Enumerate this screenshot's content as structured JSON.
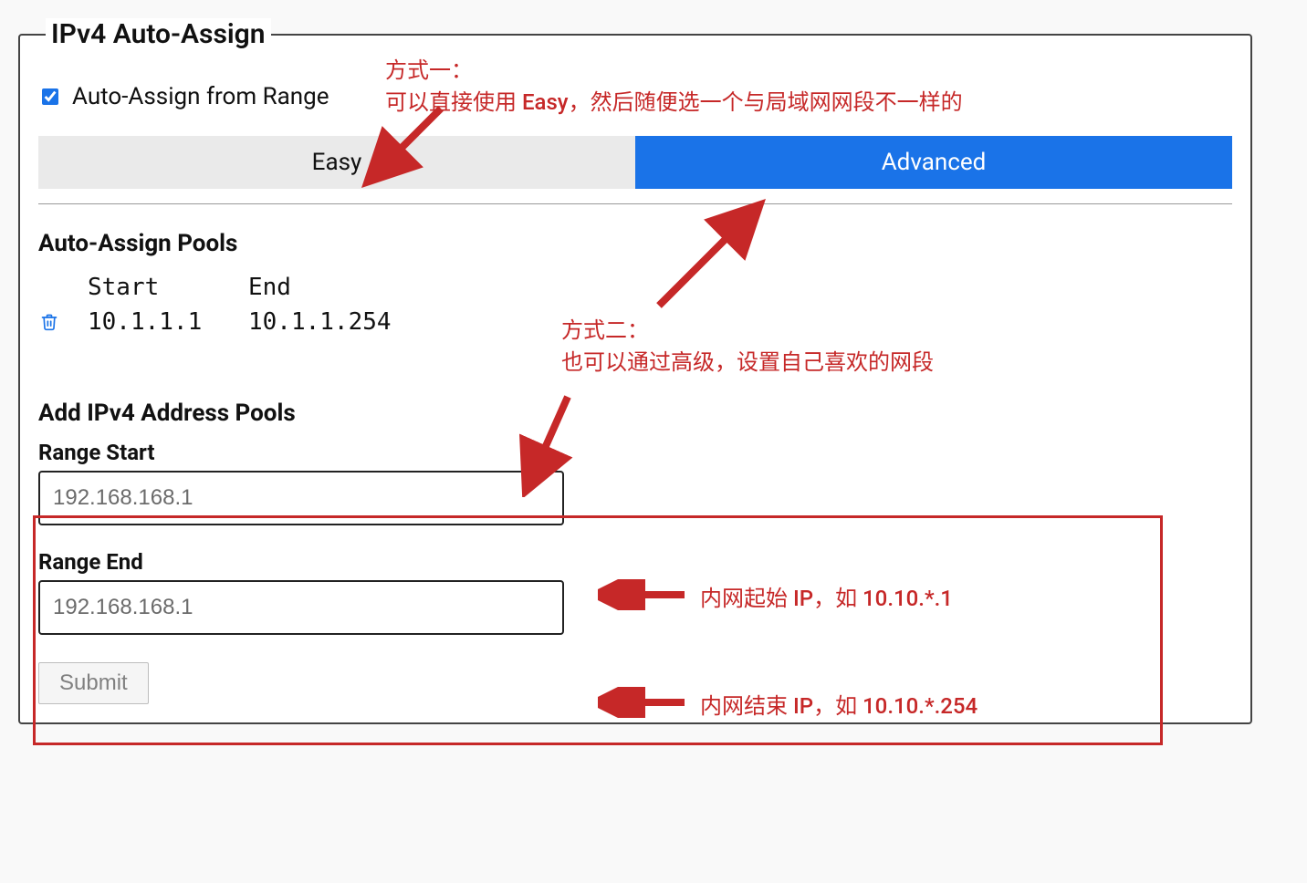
{
  "panel": {
    "title": "IPv4 Auto-Assign",
    "checkbox_label": "Auto-Assign from Range",
    "tabs": {
      "easy": "Easy",
      "advanced": "Advanced"
    },
    "pools_title": "Auto-Assign Pools",
    "pools_header": {
      "start": "Start",
      "end": "End"
    },
    "pools_row": {
      "start": "10.1.1.1",
      "end": "10.1.1.254"
    },
    "add_title": "Add IPv4 Address Pools",
    "range_start_label": "Range Start",
    "range_start_placeholder": "192.168.168.1",
    "range_end_label": "Range End",
    "range_end_placeholder": "192.168.168.1",
    "submit_label": "Submit"
  },
  "annotations": {
    "a1_line1": "方式一：",
    "a1_line2": "可以直接使用 Easy，然后随便选一个与局域网网段不一样的",
    "a2_line1": "方式二：",
    "a2_line2": "也可以通过高级，设置自己喜欢的网段",
    "a3": "内网起始 IP，如 10.10.*.1",
    "a4": "内网结束 IP，如 10.10.*.254"
  },
  "colors": {
    "annotation_red": "#c62828",
    "tab_blue": "#1a73e8",
    "delete_icon_blue": "#1a73e8"
  }
}
